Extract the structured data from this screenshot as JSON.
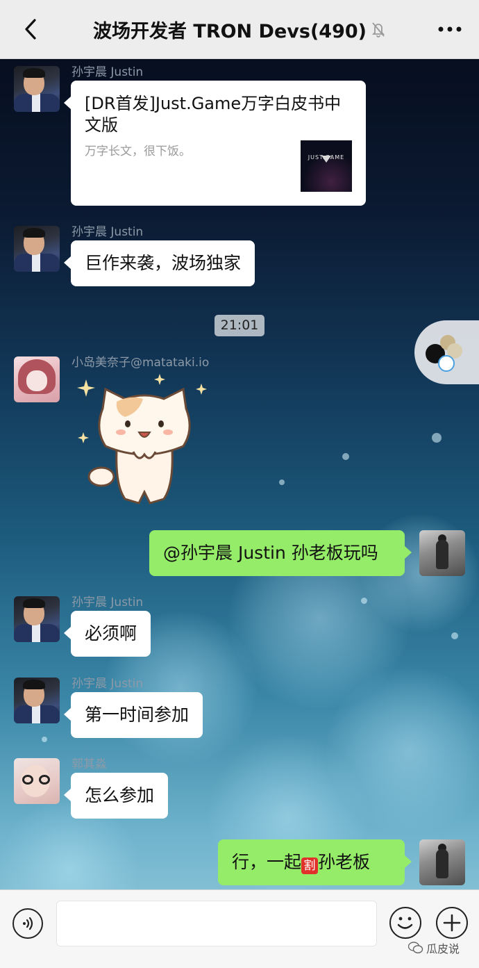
{
  "header": {
    "title": "波场开发者 TRON Devs(490)",
    "mute_icon": "bell-slash-icon",
    "back_icon": "chevron-left-icon",
    "more_icon": "more-dots-icon"
  },
  "messages": [
    {
      "sender": "孙宇晨 Justin",
      "type": "link-card",
      "card_title": "[DR首发]Just.Game万字白皮书中文版",
      "card_desc": "万字长文，很下饭。",
      "thumb_text": "JUST.GAME"
    },
    {
      "sender": "孙宇晨 Justin",
      "type": "text",
      "text": "巨作来袭，波场独家"
    },
    {
      "sender": "小岛美奈子@matataki.io",
      "type": "sticker",
      "sticker_icon": "cat-sticker-icon"
    },
    {
      "sender": "self",
      "type": "text",
      "text": "@孙宇晨 Justin 孙老板玩吗"
    },
    {
      "sender": "孙宇晨 Justin",
      "type": "text",
      "text": "必须啊"
    },
    {
      "sender": "孙宇晨 Justin",
      "type": "text",
      "text": "第一时间参加"
    },
    {
      "sender": "郭其淼",
      "type": "text",
      "text": "怎么参加"
    },
    {
      "sender": "self",
      "type": "text",
      "text_before": "行，一起",
      "emoji_text": "割",
      "text_after": "孙老板"
    }
  ],
  "timestamp": "21:01",
  "input_bar": {
    "voice_icon": "voice-icon",
    "text_value": "",
    "emoji_icon": "emoji-smile-icon",
    "plus_icon": "plus-icon"
  },
  "watermark": {
    "text": "瓜皮说",
    "icon": "wechat-icon"
  },
  "colors": {
    "header_bg": "#ededed",
    "bubble_white": "#ffffff",
    "bubble_green": "#95ec69",
    "sender_name": "#8d9aa8"
  }
}
